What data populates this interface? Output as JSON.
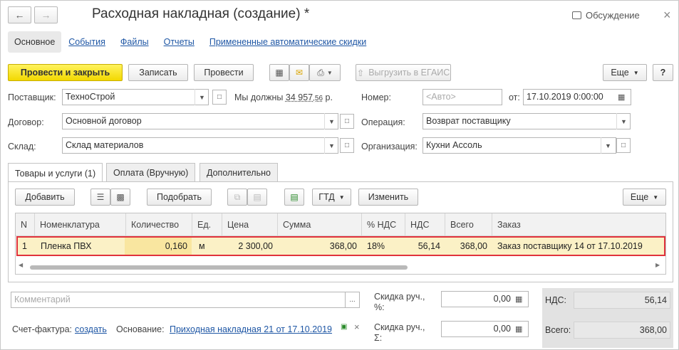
{
  "window": {
    "title": "Расходная накладная (создание) *",
    "discussion": "Обсуждение"
  },
  "sections": [
    "Основное",
    "События",
    "Файлы",
    "Отчеты",
    "Примененные автоматические скидки"
  ],
  "toolbar": {
    "post_close": "Провести и закрыть",
    "save": "Записать",
    "post": "Провести",
    "upload_egais": "Выгрузить в ЕГАИС",
    "more": "Еще",
    "help": "?"
  },
  "header": {
    "supplier_label": "Поставщик:",
    "supplier_value": "ТехноСтрой",
    "we_owe_label": "Мы должны",
    "we_owe_amount": "34 957",
    "we_owe_cents": ",56",
    "we_owe_currency": "р.",
    "number_label": "Номер:",
    "number_placeholder": "<Авто>",
    "from_label": "от:",
    "date_value": "17.10.2019  0:00:00",
    "contract_label": "Договор:",
    "contract_value": "Основной договор",
    "operation_label": "Операция:",
    "operation_value": "Возврат поставщику",
    "warehouse_label": "Склад:",
    "warehouse_value": "Склад материалов",
    "org_label": "Организация:",
    "org_value": "Кухни Ассоль"
  },
  "tabs": [
    "Товары и услуги (1)",
    "Оплата (Вручную)",
    "Дополнительно"
  ],
  "table_toolbar": {
    "add": "Добавить",
    "select": "Подобрать",
    "gtd": "ГТД",
    "change": "Изменить",
    "more": "Еще"
  },
  "table": {
    "columns": [
      "N",
      "Номенклатура",
      "Количество",
      "Ед.",
      "Цена",
      "Сумма",
      "% НДС",
      "НДС",
      "Всего",
      "Заказ"
    ],
    "rows": [
      [
        "1",
        "Пленка ПВХ",
        "0,160",
        "м",
        "2 300,00",
        "368,00",
        "18%",
        "56,14",
        "368,00",
        "Заказ поставщику 14 от 17.10.2019"
      ]
    ]
  },
  "footer": {
    "comment_placeholder": "Комментарий",
    "discount_pct_label_1": "Скидка руч.,",
    "discount_pct_label_2": "%:",
    "discount_pct_value": "0,00",
    "discount_sum_label_1": "Скидка руч.,",
    "discount_sum_label_2": "Σ:",
    "discount_sum_value": "0,00",
    "invoice_label": "Счет-фактура:",
    "invoice_link": "создать",
    "basis_label": "Основание:",
    "basis_link": "Приходная накладная 21 от 17.10.2019",
    "vat_label": "НДС:",
    "vat_value": "56,14",
    "total_label": "Всего:",
    "total_value": "368,00"
  }
}
